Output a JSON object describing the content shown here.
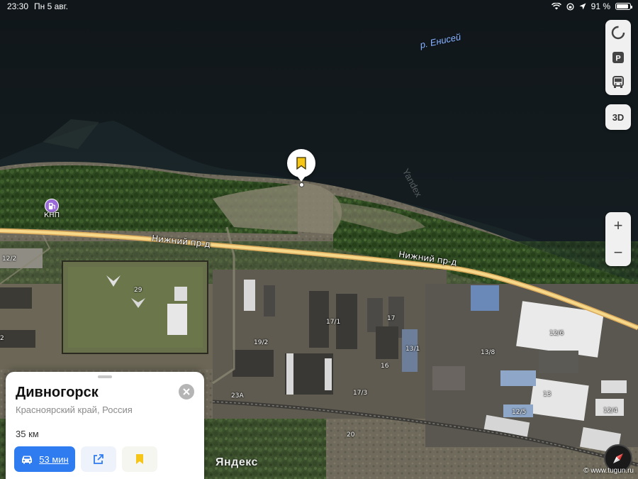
{
  "status_bar": {
    "time": "23:30",
    "date": "Пн 5 авг.",
    "battery_percent": "91 %",
    "battery_level": 0.91
  },
  "map": {
    "river_label": "р. Енисей",
    "road_label_1": "Нижний пр-д",
    "road_label_2": "Нижний пр-д",
    "gas_station_label": "КНП",
    "watermark": "Yandex",
    "logo": "Яндекс",
    "site_credit": "© www.tugun.ru",
    "building_labels": [
      "12/2",
      "29",
      "19/2",
      "17/1",
      "17",
      "13/1",
      "13/8",
      "12/6",
      "16",
      "23А",
      "17/3",
      "13",
      "12/5",
      "12/4",
      "20",
      "2"
    ]
  },
  "controls": {
    "layers": [
      "traffic-icon",
      "parking-icon",
      "transit-icon"
    ],
    "btn_3d": "3D",
    "zoom_in": "+",
    "zoom_out": "−"
  },
  "card": {
    "title": "Дивногорск",
    "subtitle": "Красноярский край, Россия",
    "distance": "35 км",
    "route_time": "53 мин",
    "accent_color": "#2f7bf0",
    "bookmark_color": "#f5c518"
  },
  "colors": {
    "road": "#f0c670",
    "water": "#121a1e",
    "forest": "#2d4a1f"
  }
}
